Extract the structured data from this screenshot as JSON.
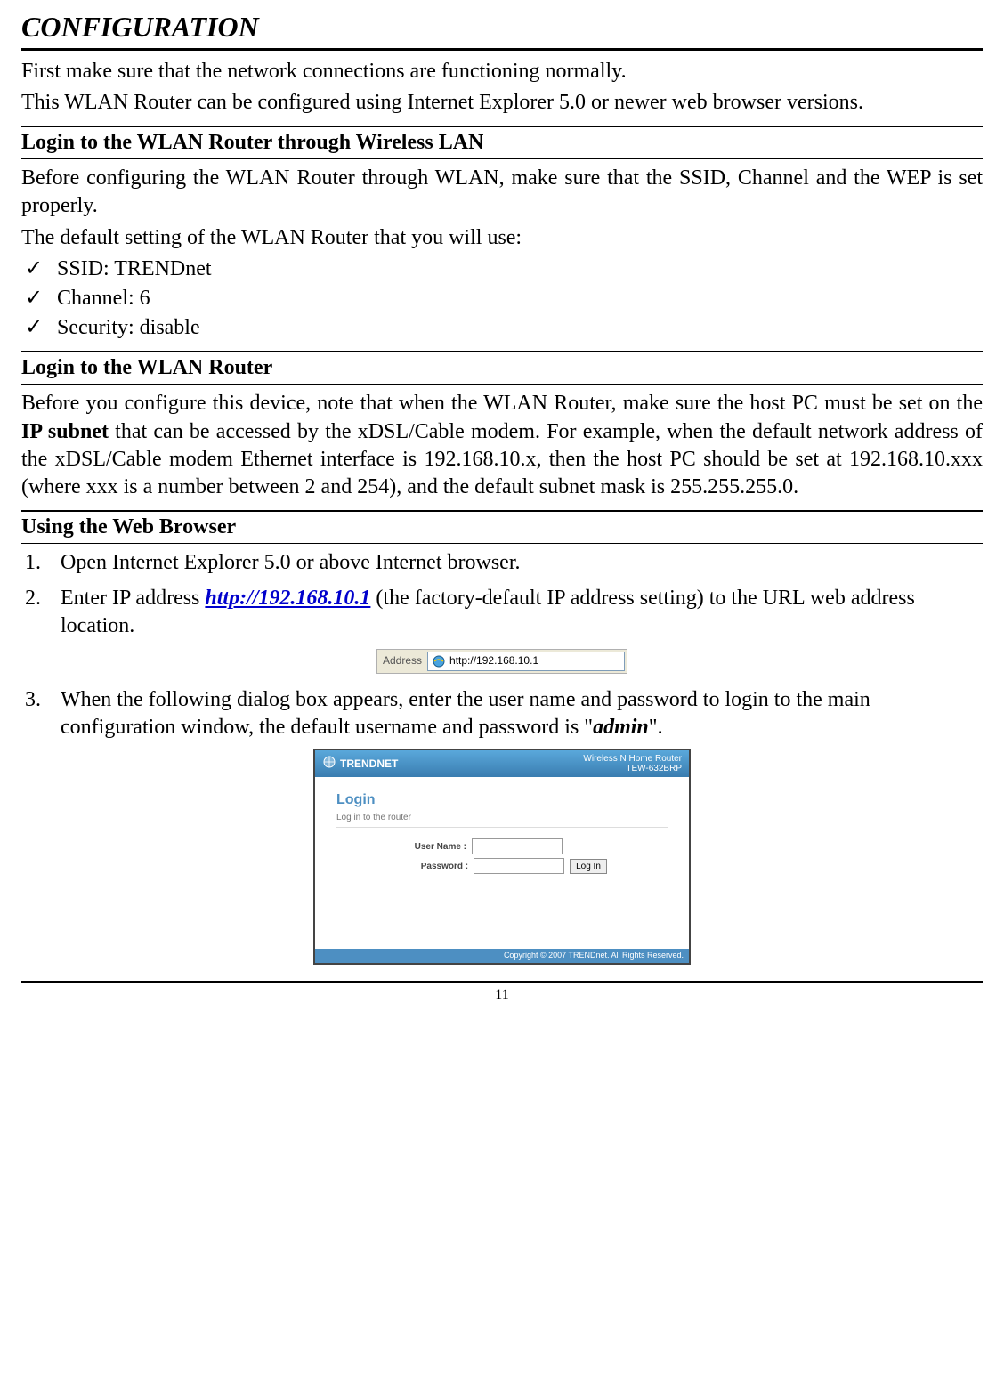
{
  "title": "CONFIGURATION",
  "intro": {
    "p1": "First make sure that the network connections are functioning normally.",
    "p2": "This WLAN Router can be configured using Internet Explorer 5.0 or newer web browser versions."
  },
  "section1": {
    "heading": "Login to the WLAN Router through Wireless LAN",
    "p1": "Before configuring the WLAN Router through WLAN, make sure that the SSID, Channel and the WEP is set properly.",
    "p2": "The default setting of the WLAN Router that you will use:",
    "items": [
      "SSID: TRENDnet",
      "Channel: 6",
      "Security: disable"
    ]
  },
  "section2": {
    "heading": "Login to the WLAN Router",
    "p_pre": "Before you configure this device, note that when the WLAN Router, make sure the host PC must be set on the ",
    "p_bold": "IP subnet",
    "p_post": " that can be accessed by the xDSL/Cable modem. For example, when the default network address of the xDSL/Cable modem Ethernet interface is 192.168.10.x, then the host PC should be set at 192.168.10.xxx (where xxx is a number between 2 and 254), and the default subnet mask is 255.255.255.0."
  },
  "section3": {
    "heading": "Using the Web Browser",
    "step1": "Open Internet Explorer 5.0 or above Internet browser.",
    "step2_pre": "Enter IP address ",
    "step2_link": "http://192.168.10.1",
    "step2_post": " (the factory-default IP address setting) to the URL web address location.",
    "step3_pre": "When the following dialog box appears, enter the user name and password to login to the main configuration window, the default username and password is \"",
    "step3_bold": "admin",
    "step3_post": "\"."
  },
  "addressbar": {
    "label": "Address",
    "url": "http://192.168.10.1"
  },
  "loginshot": {
    "brand": "TRENDNET",
    "product_line1": "Wireless N Home Router",
    "product_line2": "TEW-632BRP",
    "login_title": "Login",
    "login_sub": "Log in to the router",
    "username_label": "User Name :",
    "password_label": "Password :",
    "button": "Log In",
    "footer": "Copyright © 2007 TRENDnet. All Rights Reserved."
  },
  "pagenum": "11",
  "checkmark": "✓"
}
